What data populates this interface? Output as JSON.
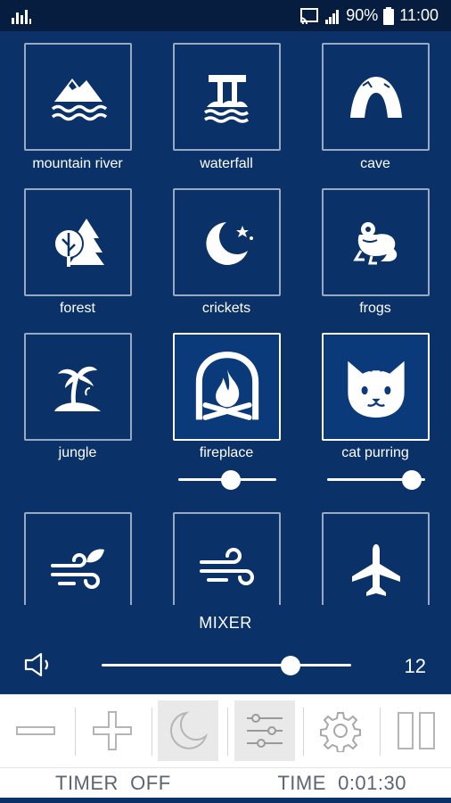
{
  "status_bar": {
    "battery": "90%",
    "time": "11:00"
  },
  "sounds": [
    {
      "label": "mountain river",
      "icon": "mountain-river-icon",
      "active": false
    },
    {
      "label": "waterfall",
      "icon": "waterfall-icon",
      "active": false
    },
    {
      "label": "cave",
      "icon": "cave-icon",
      "active": false
    },
    {
      "label": "forest",
      "icon": "forest-icon",
      "active": false
    },
    {
      "label": "crickets",
      "icon": "crickets-moon-icon",
      "active": false
    },
    {
      "label": "frogs",
      "icon": "frog-icon",
      "active": false
    },
    {
      "label": "jungle",
      "icon": "palm-island-icon",
      "active": false
    },
    {
      "label": "fireplace",
      "icon": "fireplace-icon",
      "active": true,
      "volume": 0.55
    },
    {
      "label": "cat purring",
      "icon": "cat-icon",
      "active": true,
      "volume": 0.95
    }
  ],
  "partial_row_icons": [
    "wind-leaf-icon",
    "wind-icon",
    "airplane-icon"
  ],
  "mixer": {
    "title": "MIXER",
    "volume_value": "12",
    "volume_level": 0.78
  },
  "toolbar": {
    "buttons": [
      "minus-icon",
      "plus-icon",
      "moon-icon",
      "sliders-icon",
      "gear-icon",
      "pause-icon"
    ],
    "pressed": [
      "moon-icon",
      "sliders-icon"
    ]
  },
  "footer": {
    "timer": "TIMER  OFF",
    "time": "TIME  0:01:30"
  },
  "colors": {
    "background": "#0a3168",
    "status_bar": "#061d3f",
    "toolbar": "#ffffff",
    "footer_text": "#5c6570"
  }
}
